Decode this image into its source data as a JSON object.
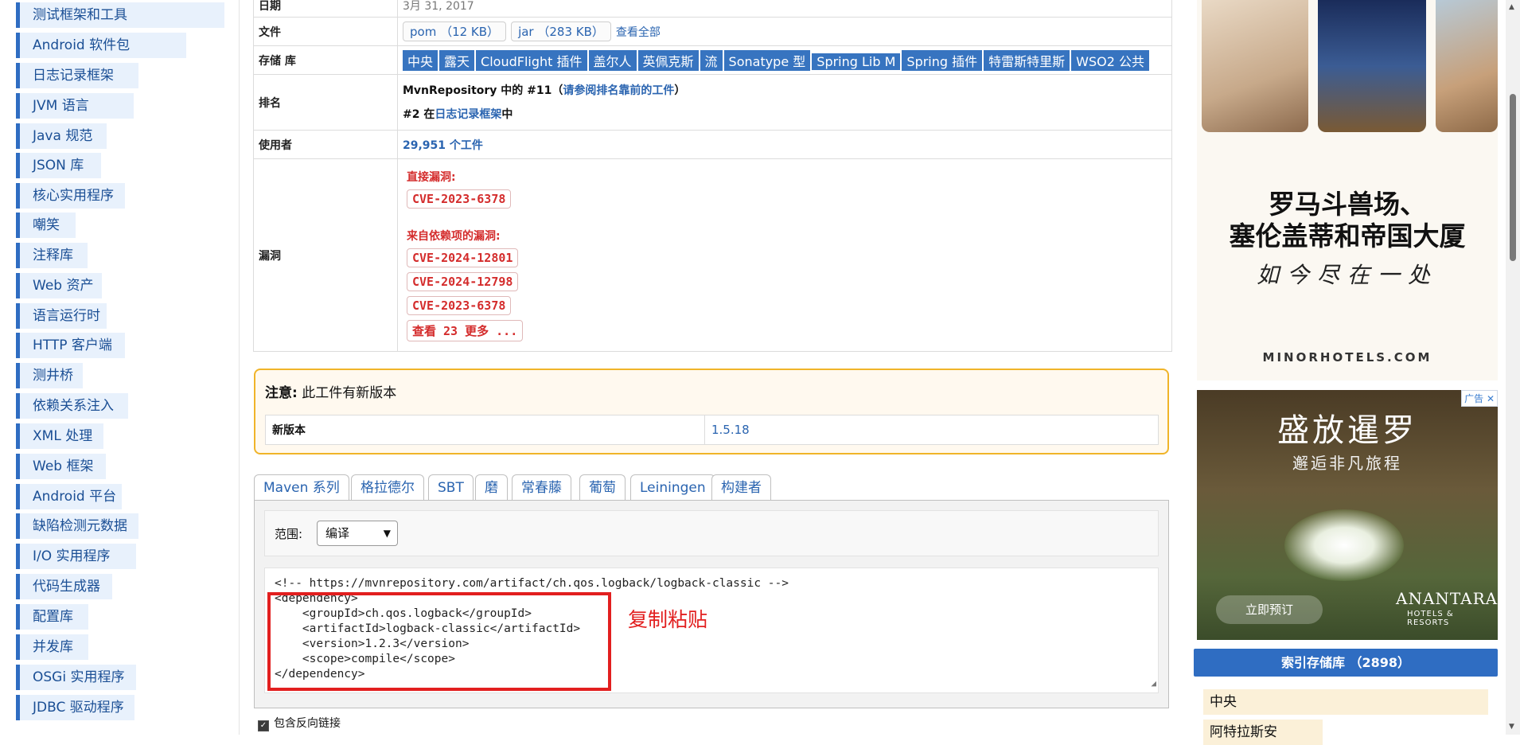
{
  "sidebar": {
    "items": [
      "测试框架和工具",
      "Android 软件包",
      "日志记录框架",
      "JVM 语言",
      "Java 规范",
      "JSON 库",
      "核心实用程序",
      "嘲笑",
      "注释库",
      "Web 资产",
      "语言运行时",
      "HTTP 客户端",
      "测井桥",
      "依赖关系注入",
      "XML 处理",
      "Web 框架",
      "Android 平台",
      "缺陷检测元数据",
      "I/O 实用程序",
      "代码生成器",
      "配置库",
      "并发库",
      "OSGi 实用程序",
      "JDBC 驱动程序"
    ]
  },
  "info": {
    "date_label": "日期",
    "date_value": "3月 31, 2017",
    "files_label": "文件",
    "file_pom": "pom （12 KB）",
    "file_jar": "jar （283 KB）",
    "view_all": "查看全部",
    "repos_label": "存储 库",
    "repos": [
      "中央",
      "露天",
      "CloudFlight 插件",
      "盖尔人",
      "英佩克斯",
      "流",
      "Sonatype 型",
      "Spring Lib M",
      "Spring 插件",
      "特雷斯特里斯",
      "WSO2 公共"
    ],
    "rank_label": "排名",
    "rank_line1_a": "MvnRepository 中的 #11（",
    "rank_line1_link": "请参阅排名靠前的工件",
    "rank_line1_b": "）",
    "rank_line2_a": "#2 在",
    "rank_line2_link": "日志记录框架",
    "rank_line2_b": "中",
    "used_label": "使用者",
    "used_value": "29,951 个工件",
    "vuln_label": "漏洞",
    "vuln_direct_title": "直接漏洞:",
    "vuln_direct": [
      "CVE-2023-6378"
    ],
    "vuln_dep_title": "来自依赖项的漏洞:",
    "vuln_dep": [
      "CVE-2024-12801",
      "CVE-2024-12798",
      "CVE-2023-6378"
    ],
    "vuln_more": "查看 23 更多 ..."
  },
  "notice": {
    "title_bold": "注意:",
    "title_rest": " 此工件有新版本",
    "new_version_label": "新版本",
    "new_version_value": "1.5.18"
  },
  "tabs": [
    "Maven 系列",
    "格拉德尔",
    "SBT",
    "磨",
    "常春藤",
    "葡萄",
    "Leiningen",
    "构建者"
  ],
  "scope": {
    "label": "范围:",
    "value": "编译"
  },
  "code": {
    "comment": "<!-- https://mvnrepository.com/artifact/ch.qos.logback/logback-classic -->",
    "lines": [
      "<dependency>",
      "    <groupId>ch.qos.logback</groupId>",
      "    <artifactId>logback-classic</artifactId>",
      "    <version>1.2.3</version>",
      "    <scope>compile</scope>",
      "</dependency>"
    ],
    "annotation": "复制粘贴"
  },
  "include_backlinks": "包含反向链接",
  "ads": {
    "ad1_line1": "罗马斗兽场、",
    "ad1_line2": "塞伦盖蒂和帝国大厦",
    "ad1_line3": "如今尽在一处",
    "ad1_site": "MINORHOTELS.COM",
    "ad2_badge": "广告",
    "ad2_title": "盛放暹罗",
    "ad2_sub": "邂逅非凡旅程",
    "ad2_button": "立即预订",
    "ad2_brand": "ANANTARA",
    "ad2_brand_sub": "HOTELS & RESORTS"
  },
  "index": {
    "button": "索引存储库 （2898）",
    "items": [
      "中央",
      "阿特拉斯安"
    ]
  },
  "colors": {
    "accent": "#2f6dc2",
    "danger": "#d42c2c",
    "notice_border": "#f0b429"
  }
}
